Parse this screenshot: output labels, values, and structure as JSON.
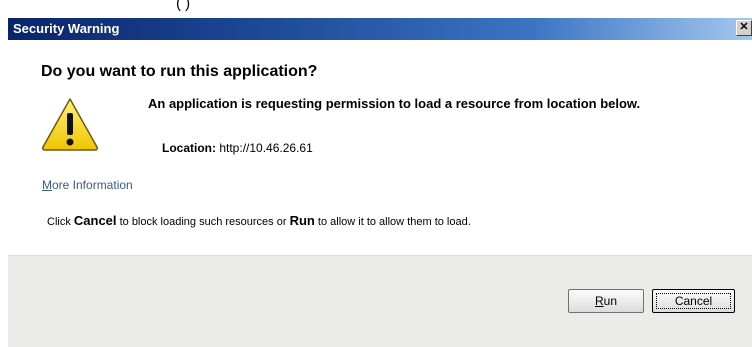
{
  "background_window": {
    "partial_text": "(                    )"
  },
  "dialog": {
    "title": "Security Warning",
    "close_glyph": "✕",
    "headline": "Do you want to run this application?",
    "message": "An application is requesting permission to load a resource from location below.",
    "location_label": "Location:",
    "location_value": "http://10.46.26.61",
    "more_info": {
      "mnemonic": "M",
      "rest": "ore Information"
    },
    "instruction": {
      "part1": "Click ",
      "cancel_word": "Cancel",
      "part2": " to block loading such resources or ",
      "run_word": "Run",
      "part3": " to allow it to allow them to load."
    },
    "buttons": {
      "run": {
        "mnemonic": "R",
        "rest": "un"
      },
      "cancel": {
        "label": "Cancel"
      }
    },
    "icon": "warning-icon"
  },
  "colors": {
    "titlebar_start": "#0a246a",
    "titlebar_end": "#a6caf0",
    "warning_fill": "#f5d60e",
    "link": "#3a5a8a"
  }
}
